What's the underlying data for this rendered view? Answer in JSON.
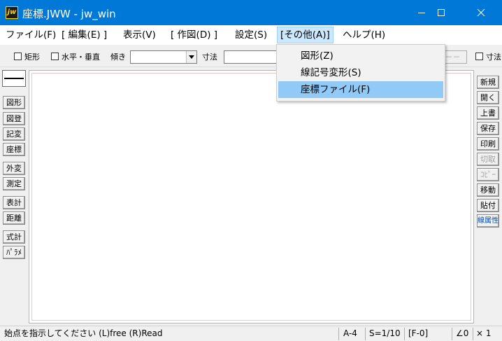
{
  "window": {
    "title": "座標.JWW - jw_win",
    "app_icon_text": "jw",
    "accent": "#0078d7"
  },
  "menubar": {
    "items": [
      {
        "label": "ファイル(F)"
      },
      {
        "label": "[ 編集(E) ]"
      },
      {
        "label": "表示(V)"
      },
      {
        "label": "[ 作図(D) ]"
      },
      {
        "label": "設定(S)"
      },
      {
        "label": "[その他(A)]",
        "active": true
      },
      {
        "label": "ヘルプ(H)"
      }
    ]
  },
  "dropdown": {
    "items": [
      {
        "label": "図形(Z)"
      },
      {
        "label": "線記号変形(S)"
      },
      {
        "label": "座標ファイル(F)",
        "selected": true
      }
    ]
  },
  "toolbar": {
    "rect_label": "矩形",
    "hv_label": "水平・垂直",
    "angle_label": "傾き",
    "angle_value": "",
    "size_label": "寸法",
    "size_value": "",
    "dash_button": "－－",
    "right_label": "寸法"
  },
  "left_tools": [
    "図形",
    "図登",
    "記変",
    "座標",
    "外変",
    "測定",
    "表計",
    "距離",
    "式計",
    "ﾊﾟﾗﾒ"
  ],
  "right_tools": [
    {
      "label": "新規"
    },
    {
      "label": "開く"
    },
    {
      "label": "上書"
    },
    {
      "label": "保存"
    },
    {
      "label": "印刷"
    },
    {
      "label": "切取",
      "disabled": true
    },
    {
      "label": "ｺﾋﾟｰ",
      "disabled": true
    },
    {
      "label": "移動"
    },
    {
      "label": "貼付"
    },
    {
      "label": "線属性",
      "accent": true
    }
  ],
  "statusbar": {
    "message": "始点を指示してください (L)free (R)Read",
    "paper": "A-4",
    "scale": "S=1/10",
    "layer": "[F-0]",
    "angle": "∠0",
    "zoom": "× 1"
  }
}
